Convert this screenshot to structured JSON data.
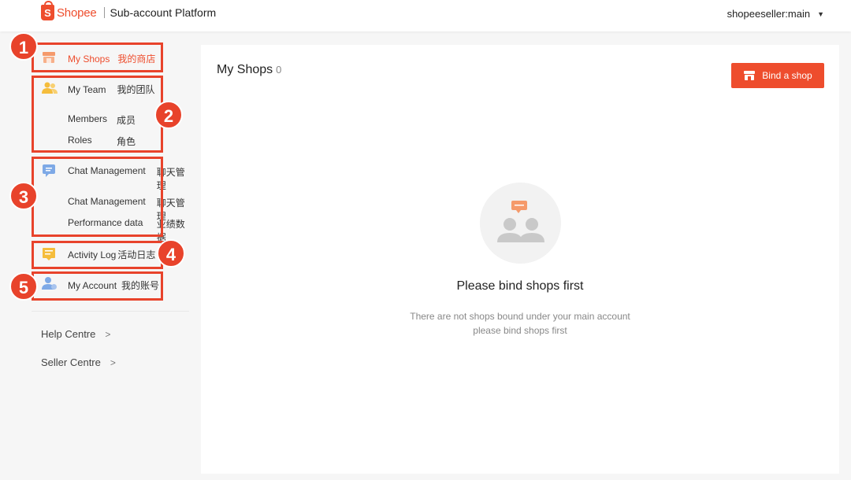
{
  "header": {
    "logo_mark": "S",
    "logo_text": "Shopee",
    "platform_title": "Sub-account Platform",
    "account_name": "shopeeseller:main",
    "account_caret": "▼"
  },
  "sidebar": {
    "items": [
      {
        "label": "My Shops",
        "label_cn": "我的商店",
        "icon": "shop-icon",
        "active": true
      },
      {
        "label": "My Team",
        "label_cn": "我的团队",
        "icon": "team-icon",
        "children": [
          {
            "label": "Members",
            "label_cn": "成员"
          },
          {
            "label": "Roles",
            "label_cn": "角色"
          }
        ]
      },
      {
        "label": "Chat Management",
        "label_cn": "聊天管理",
        "icon": "chat-icon",
        "children": [
          {
            "label": "Chat Management",
            "label_cn": "聊天管理"
          },
          {
            "label": "Performance data",
            "label_cn": "业绩数据"
          }
        ]
      },
      {
        "label": "Activity Log",
        "label_cn": "活动日志",
        "icon": "activity-log-icon"
      },
      {
        "label": "My Account",
        "label_cn": "我的账号",
        "icon": "account-icon"
      }
    ],
    "links": [
      {
        "label": "Help Centre",
        "chevron": ">"
      },
      {
        "label": "Seller Centre",
        "chevron": ">"
      }
    ]
  },
  "annotations": [
    "1",
    "2",
    "3",
    "4",
    "5"
  ],
  "main": {
    "title": "My Shops",
    "count": "0",
    "bind_button_label": "Bind a shop",
    "empty_title": "Please bind shops first",
    "empty_desc_line1": "There are not shops bound under your main account",
    "empty_desc_line2": "please bind shops first"
  },
  "colors": {
    "brand": "#ee4d2d",
    "annotation": "#e8432b",
    "page_bg": "#f6f6f6",
    "icon_orange": "#f59a6b",
    "icon_yellow": "#f5bd3c",
    "icon_blue": "#7ea9e6"
  }
}
